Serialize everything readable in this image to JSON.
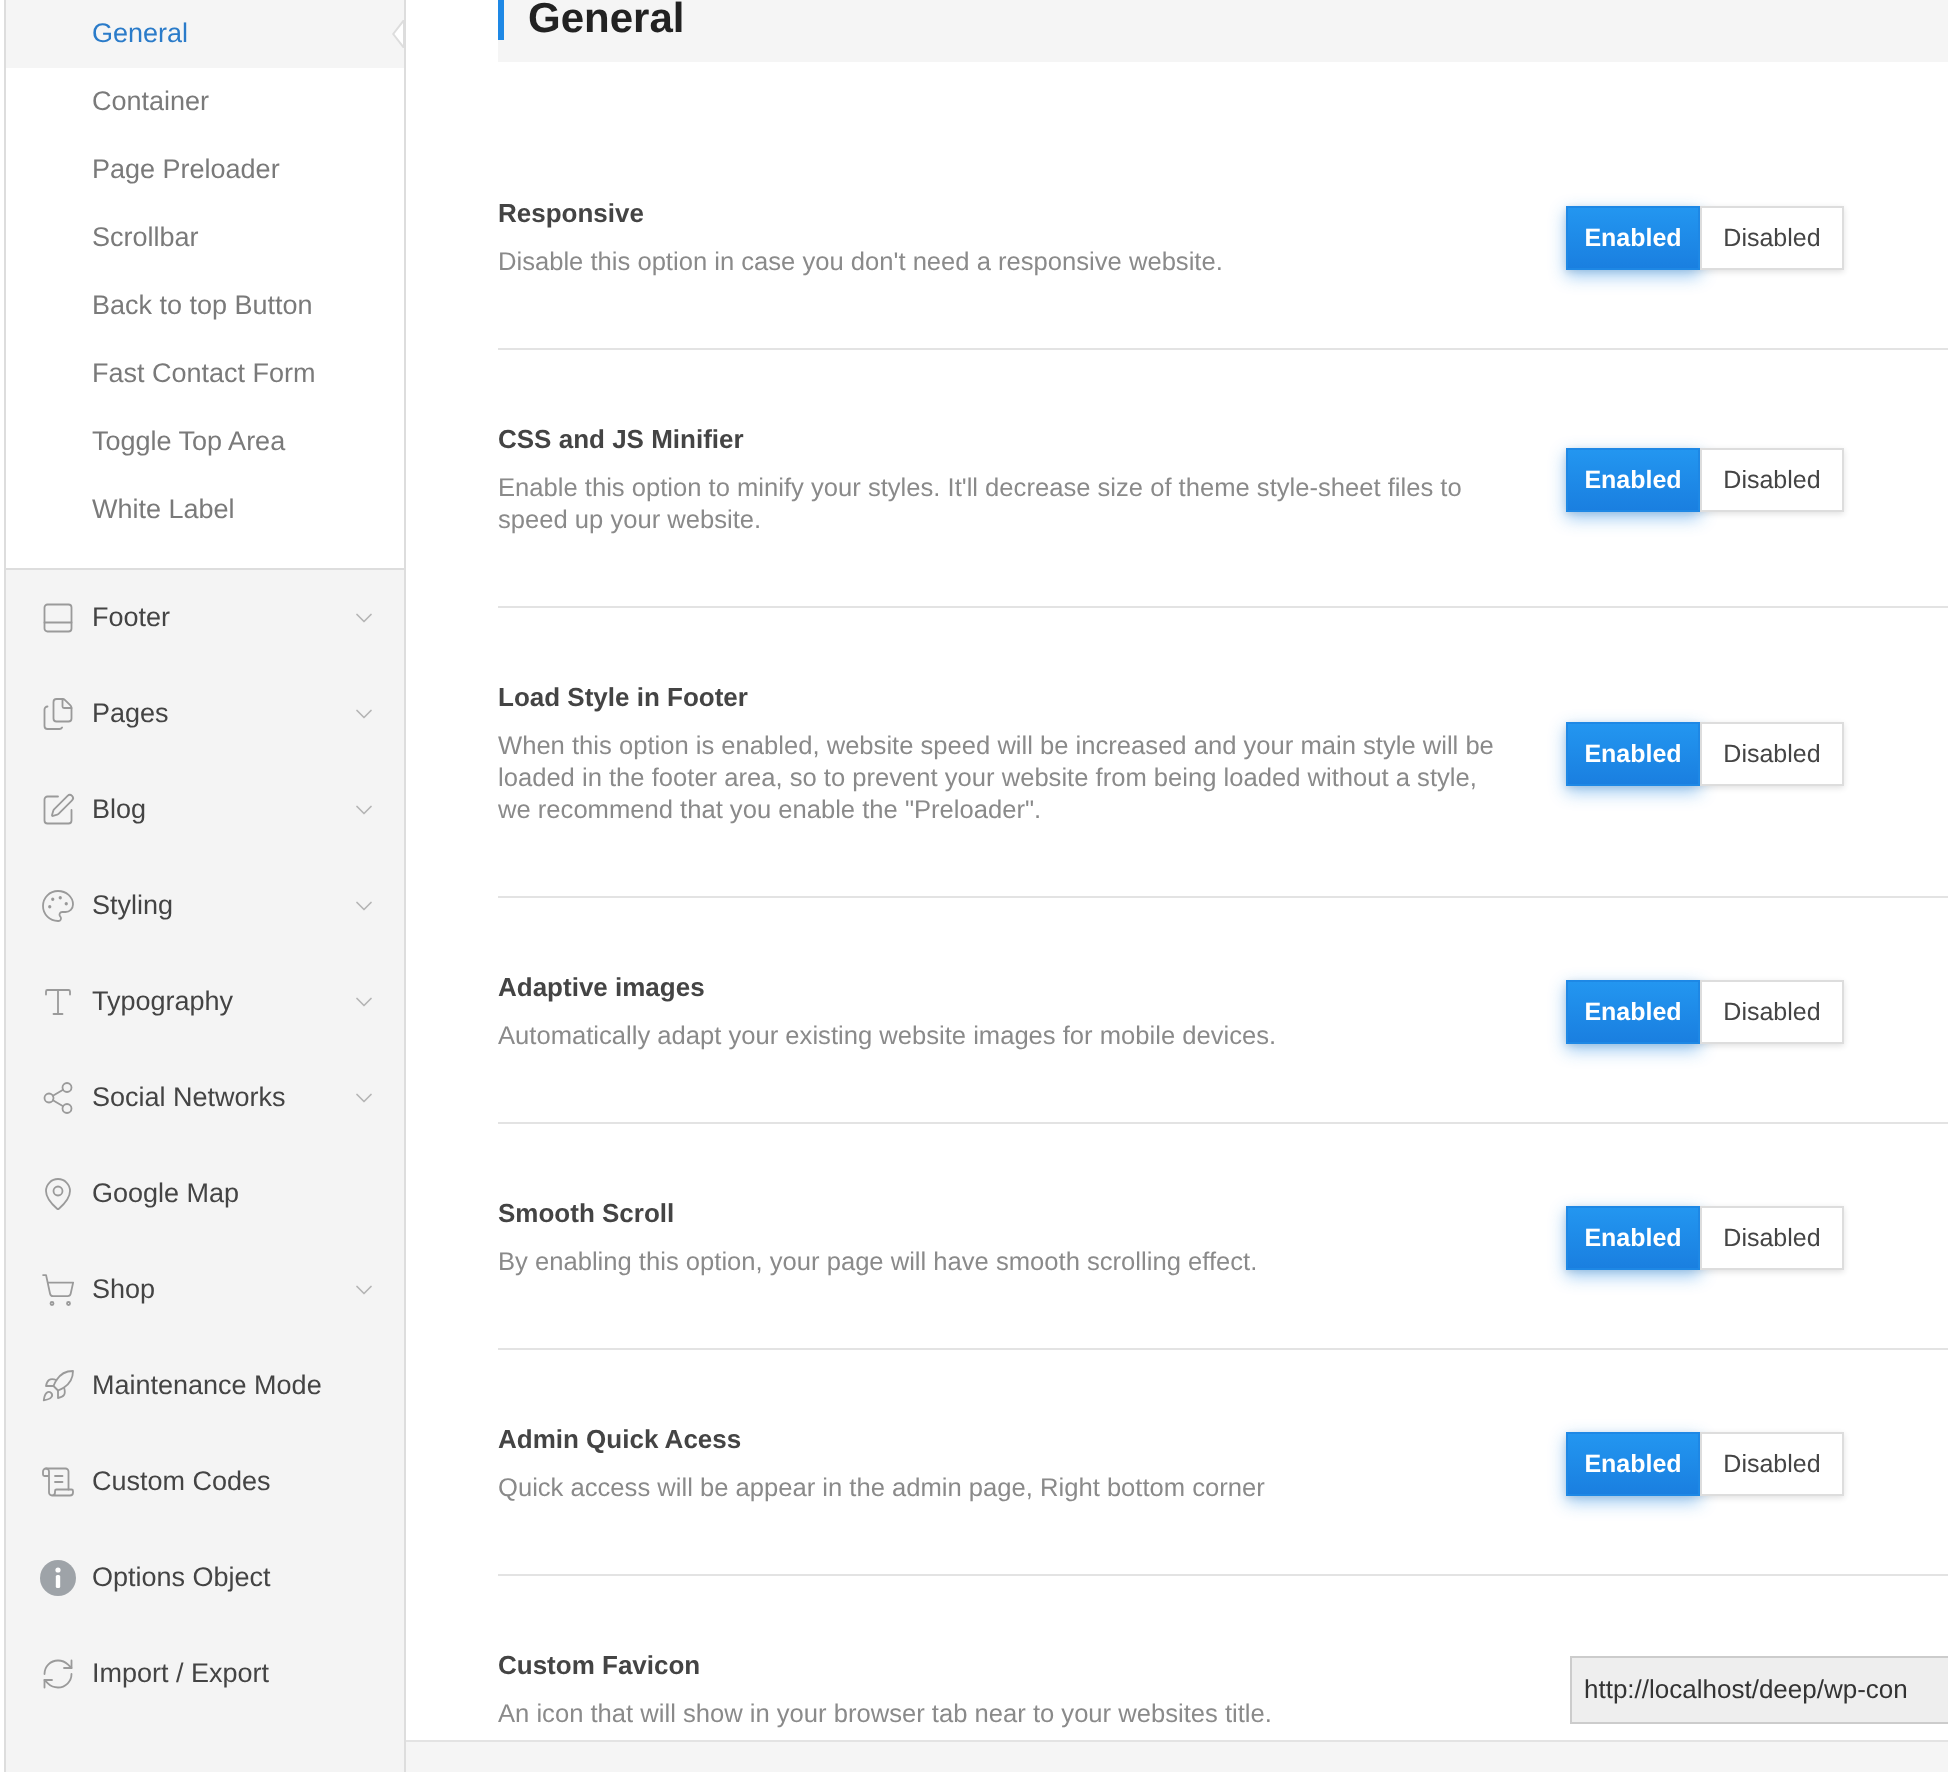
{
  "sidebar": {
    "submenu": [
      {
        "label": "General",
        "selected": true
      },
      {
        "label": "Container",
        "selected": false
      },
      {
        "label": "Page Preloader",
        "selected": false
      },
      {
        "label": "Scrollbar",
        "selected": false
      },
      {
        "label": "Back to top Button",
        "selected": false
      },
      {
        "label": "Fast Contact Form",
        "selected": false
      },
      {
        "label": "Toggle Top Area",
        "selected": false
      },
      {
        "label": "White Label",
        "selected": false
      }
    ],
    "items": [
      {
        "label": "Footer",
        "submenu": true
      },
      {
        "label": "Pages",
        "submenu": true
      },
      {
        "label": "Blog",
        "submenu": true
      },
      {
        "label": "Styling",
        "submenu": true
      },
      {
        "label": "Typography",
        "submenu": true
      },
      {
        "label": "Social Networks",
        "submenu": true
      },
      {
        "label": "Google Map",
        "submenu": false
      },
      {
        "label": "Shop",
        "submenu": true
      },
      {
        "label": "Maintenance Mode",
        "submenu": false
      },
      {
        "label": "Custom Codes",
        "submenu": false
      },
      {
        "label": "Options Object",
        "submenu": false
      },
      {
        "label": "Import / Export",
        "submenu": false
      }
    ]
  },
  "page": {
    "title": "General"
  },
  "settings": [
    {
      "kind": "toggle",
      "title": "Responsive",
      "description": "Disable this option in case you don't need a responsive website.",
      "options": [
        {
          "label": "Enabled",
          "selected": true
        },
        {
          "label": "Disabled",
          "selected": false
        }
      ]
    },
    {
      "kind": "toggle",
      "title": "CSS and JS Minifier",
      "description": "Enable this option to minify your styles. It'll decrease size of theme style-sheet files to speed up your website.",
      "options": [
        {
          "label": "Enabled",
          "selected": true
        },
        {
          "label": "Disabled",
          "selected": false
        }
      ]
    },
    {
      "kind": "toggle",
      "title": "Load Style in Footer",
      "description": "When this option is enabled, website speed will be increased and your main style will be loaded in the footer area, so to prevent your website from being loaded without a style, we recommend that you enable the \"Preloader\".",
      "options": [
        {
          "label": "Enabled",
          "selected": true
        },
        {
          "label": "Disabled",
          "selected": false
        }
      ]
    },
    {
      "kind": "toggle",
      "title": "Adaptive images",
      "description": "Automatically adapt your existing website images for mobile devices.",
      "options": [
        {
          "label": "Enabled",
          "selected": true
        },
        {
          "label": "Disabled",
          "selected": false
        }
      ]
    },
    {
      "kind": "toggle",
      "title": "Smooth Scroll",
      "description": "By enabling this option, your page will have smooth scrolling effect.",
      "options": [
        {
          "label": "Enabled",
          "selected": true
        },
        {
          "label": "Disabled",
          "selected": false
        }
      ]
    },
    {
      "kind": "toggle",
      "title": "Admin Quick Acess",
      "description": "Quick access will be appear in the admin page, Right bottom corner",
      "options": [
        {
          "label": "Enabled",
          "selected": true
        },
        {
          "label": "Disabled",
          "selected": false
        }
      ]
    },
    {
      "kind": "url",
      "title": "Custom Favicon",
      "description": "An icon that will show in your browser tab near to your websites title.",
      "value": "http://localhost/deep/wp-con"
    }
  ]
}
